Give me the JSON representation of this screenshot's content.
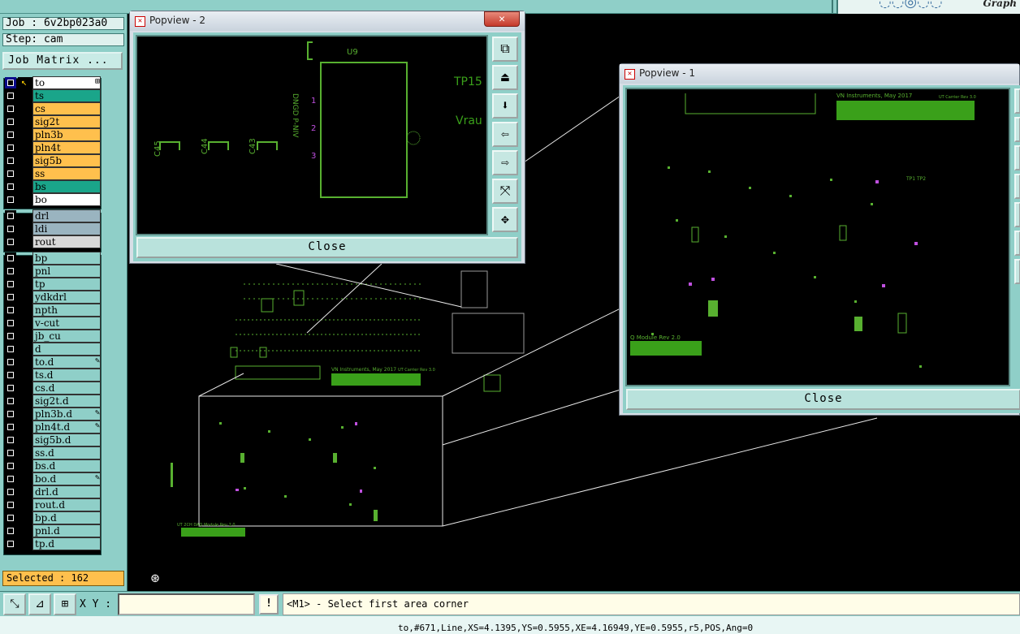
{
  "job_label": "Job : 6v2bp023a0",
  "step_label": "Step: cam",
  "job_matrix_button": "Job Matrix ...",
  "brand_text": "Graph",
  "layers": [
    {
      "name": "to",
      "color": "#ffffff",
      "active": true
    },
    {
      "name": "ts",
      "color": "#1aa58a"
    },
    {
      "name": "cs",
      "color": "#ffc04d"
    },
    {
      "name": "sig2t",
      "color": "#ffc04d"
    },
    {
      "name": "pln3b",
      "color": "#ffc04d"
    },
    {
      "name": "pln4t",
      "color": "#ffc04d"
    },
    {
      "name": "sig5b",
      "color": "#ffc04d"
    },
    {
      "name": "ss",
      "color": "#ffc04d"
    },
    {
      "name": "bs",
      "color": "#1aa58a"
    },
    {
      "name": "bo",
      "color": "#ffffff"
    },
    {
      "name": "drl",
      "color": "#9ab4c0"
    },
    {
      "name": "ldi",
      "color": "#9ab4c0"
    },
    {
      "name": "rout",
      "color": "#d8d8d8"
    },
    {
      "name": "bp",
      "color": "#8fcfc8"
    },
    {
      "name": "pnl",
      "color": "#8fcfc8"
    },
    {
      "name": "tp",
      "color": "#8fcfc8"
    },
    {
      "name": "ydkdrl",
      "color": "#8fcfc8"
    },
    {
      "name": "npth",
      "color": "#8fcfc8"
    },
    {
      "name": "v-cut",
      "color": "#8fcfc8"
    },
    {
      "name": "jb_cu",
      "color": "#8fcfc8"
    },
    {
      "name": "d",
      "color": "#8fcfc8"
    },
    {
      "name": "to.d",
      "color": "#8fcfc8",
      "pen": true
    },
    {
      "name": "ts.d",
      "color": "#8fcfc8"
    },
    {
      "name": "cs.d",
      "color": "#8fcfc8"
    },
    {
      "name": "sig2t.d",
      "color": "#8fcfc8"
    },
    {
      "name": "pln3b.d",
      "color": "#8fcfc8",
      "pen": true
    },
    {
      "name": "pln4t.d",
      "color": "#8fcfc8",
      "pen": true
    },
    {
      "name": "sig5b.d",
      "color": "#8fcfc8"
    },
    {
      "name": "ss.d",
      "color": "#8fcfc8"
    },
    {
      "name": "bs.d",
      "color": "#8fcfc8"
    },
    {
      "name": "bo.d",
      "color": "#8fcfc8",
      "pen": true
    },
    {
      "name": "drl.d",
      "color": "#8fcfc8"
    },
    {
      "name": "rout.d",
      "color": "#8fcfc8"
    },
    {
      "name": "bp.d",
      "color": "#8fcfc8"
    },
    {
      "name": "pnl.d",
      "color": "#8fcfc8"
    },
    {
      "name": "tp.d",
      "color": "#8fcfc8"
    }
  ],
  "selected_label": "Selected : 162",
  "popview2": {
    "title": "Popview - 2",
    "close_label": "Close",
    "labels": {
      "u9": "U9",
      "tp15": "TP15",
      "vrau": "Vrau",
      "c45": "C45",
      "c44": "C44",
      "c43": "C43",
      "pwr": "DNGD P-NIV",
      "pin1": "1",
      "pin2": "2",
      "pin3": "3"
    }
  },
  "popview1": {
    "title": "Popview - 1",
    "close_label": "Close",
    "labels": {
      "brand": "VN Instruments, May 2017",
      "rev": "UT Carrier Rev 3.0",
      "module": "Q Module Rev 2.0",
      "tp": "TP1  TP2"
    }
  },
  "main_canvas": {
    "brand": "VN Instruments, May 2017",
    "rev": "UT Carrier Rev 3.0",
    "module": "UT 2CH DAQ Module Rev 2.0"
  },
  "command": {
    "xy_label": "X Y :",
    "xy_value": "",
    "bang": "!",
    "prompt": "<M1> - Select first area corner"
  },
  "status_text": "to,#671,Line,XS=4.1395,YS=0.5955,XE=4.16949,YE=0.5955,r5,POS,Ang=0"
}
